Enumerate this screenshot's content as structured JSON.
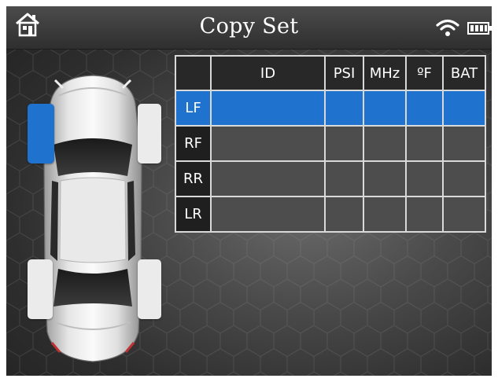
{
  "header": {
    "title": "Copy Set",
    "icons": [
      "home-icon",
      "wifi-icon",
      "battery-icon"
    ]
  },
  "colors": {
    "accent": "#1f73cf",
    "header_bg": "#3a3a3a",
    "table_cell": "#4d4d4d",
    "grid_line": "#d9d9d9"
  },
  "tpms_table": {
    "columns": [
      "",
      "ID",
      "PSI",
      "MHz",
      "ºF",
      "BAT"
    ],
    "rows": [
      {
        "position": "LF",
        "id": "",
        "psi": "",
        "mhz": "",
        "temp": "",
        "bat": "",
        "selected": true
      },
      {
        "position": "RF",
        "id": "",
        "psi": "",
        "mhz": "",
        "temp": "",
        "bat": "",
        "selected": false
      },
      {
        "position": "RR",
        "id": "",
        "psi": "",
        "mhz": "",
        "temp": "",
        "bat": "",
        "selected": false
      },
      {
        "position": "LR",
        "id": "",
        "psi": "",
        "mhz": "",
        "temp": "",
        "bat": "",
        "selected": false
      }
    ]
  },
  "vehicle": {
    "selected_tire": "LF",
    "tires": [
      "LF",
      "RF",
      "LR",
      "RR"
    ]
  }
}
